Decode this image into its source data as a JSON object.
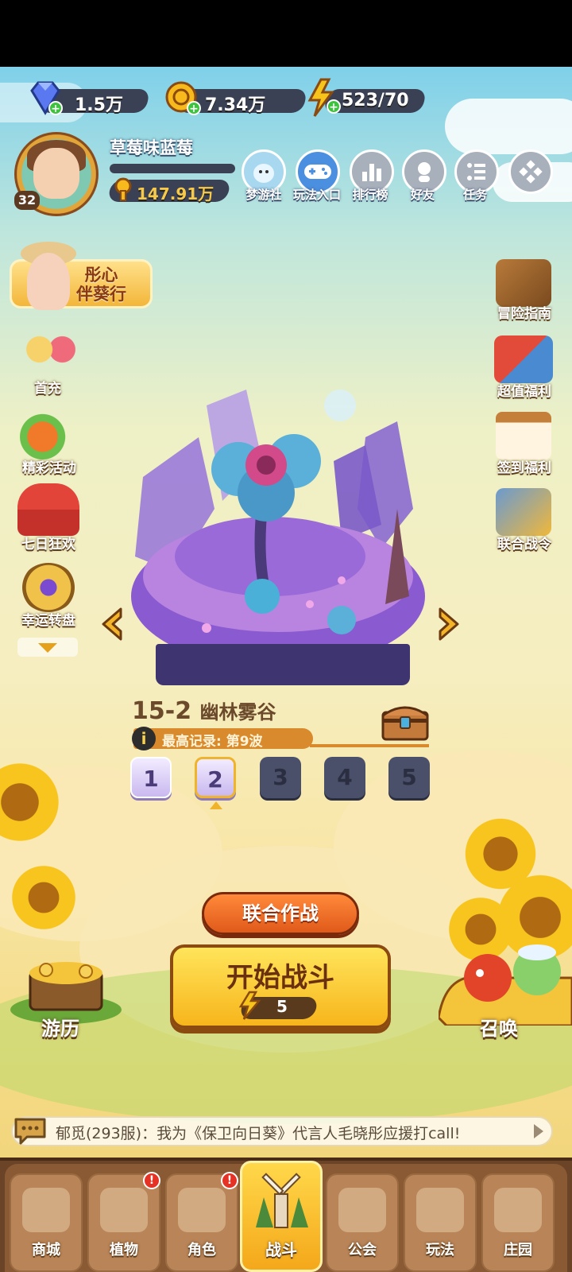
{
  "resources": {
    "diamonds": "1.5万",
    "coins": "7.34万",
    "energy": "523/70"
  },
  "player": {
    "name": "草莓味蓝莓",
    "level": "32",
    "gold": "147.91万",
    "xp_progress": 0.0
  },
  "top_menu": [
    {
      "label": "梦游社",
      "icon": "creature-icon"
    },
    {
      "label": "玩法入口",
      "icon": "gamepad-icon"
    },
    {
      "label": "排行榜",
      "icon": "chart-icon"
    },
    {
      "label": "好友",
      "icon": "friend-icon"
    },
    {
      "label": "任务",
      "icon": "task-icon"
    },
    {
      "label": "",
      "icon": "more-icon"
    }
  ],
  "promo": {
    "text_line1": "彤心",
    "text_line2": "伴葵行"
  },
  "left_menu": [
    {
      "label": "首充"
    },
    {
      "label": "精彩活动"
    },
    {
      "label": "七日狂欢"
    },
    {
      "label": "幸运转盘"
    }
  ],
  "right_menu": [
    {
      "label": "冒险指南"
    },
    {
      "label": "超值福利"
    },
    {
      "label": "签到福利"
    },
    {
      "label": "联合战令"
    }
  ],
  "stage": {
    "number": "15-2",
    "name": "幽林雾谷",
    "record_label": "最高记录: 第9波",
    "record_icon": "i",
    "waves": [
      "1",
      "2",
      "3",
      "4",
      "5"
    ],
    "selected_wave": "2"
  },
  "buttons": {
    "coop": "联合作战",
    "start": "开始战斗",
    "start_cost": "5"
  },
  "corners": {
    "left": "游历",
    "right": "召唤"
  },
  "news": {
    "text": "郁觅(293服)：我为《保卫向日葵》代言人毛晓彤应援打call!"
  },
  "bottom_nav": [
    {
      "label": "商城",
      "badge": "",
      "active": false
    },
    {
      "label": "植物",
      "badge": "!",
      "active": false
    },
    {
      "label": "角色",
      "badge": "!",
      "active": false
    },
    {
      "label": "战斗",
      "badge": "",
      "active": true
    },
    {
      "label": "公会",
      "badge": "",
      "active": false
    },
    {
      "label": "玩法",
      "badge": "",
      "active": false
    },
    {
      "label": "庄园",
      "badge": "",
      "active": false
    }
  ],
  "colors": {
    "accent_orange": "#e05a1a",
    "start_yellow": "#f7b51c",
    "resource_pill": "#3b4154",
    "badge_red": "#e53224"
  }
}
